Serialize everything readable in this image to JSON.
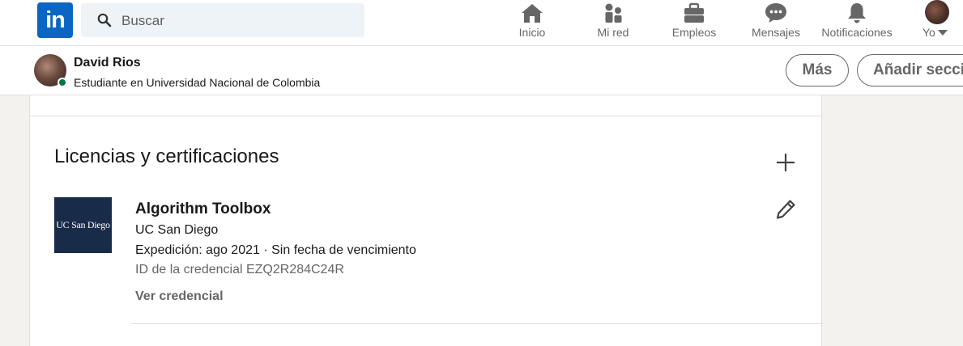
{
  "nav": {
    "logo_text": "in",
    "search_placeholder": "Buscar",
    "items": [
      {
        "label": "Inicio",
        "icon": "home-icon"
      },
      {
        "label": "Mi red",
        "icon": "my-network-icon"
      },
      {
        "label": "Empleos",
        "icon": "briefcase-icon"
      },
      {
        "label": "Mensajes",
        "icon": "messaging-icon"
      },
      {
        "label": "Notificaciones",
        "icon": "bell-icon"
      },
      {
        "label": "Yo",
        "icon": "avatar"
      }
    ]
  },
  "profile_bar": {
    "name": "David Rios",
    "headline": "Estudiante en Universidad Nacional de Colombia",
    "more_button": "Más",
    "add_section_button": "Añadir sección"
  },
  "certifications": {
    "section_title": "Licencias y certificaciones",
    "items": [
      {
        "title": "Algorithm Toolbox",
        "org": "UC San Diego",
        "org_logo_text": "UC San Diego",
        "dates": "Expedición: ago 2021 · Sin fecha de vencimiento",
        "credential_id": "ID de la credencial EZQ2R284C24R",
        "link": "Ver credencial"
      }
    ]
  },
  "colors": {
    "brand": "#0a66c2",
    "online": "#057642",
    "ucsd_navy": "#182b49",
    "background": "#f3f2ef"
  }
}
